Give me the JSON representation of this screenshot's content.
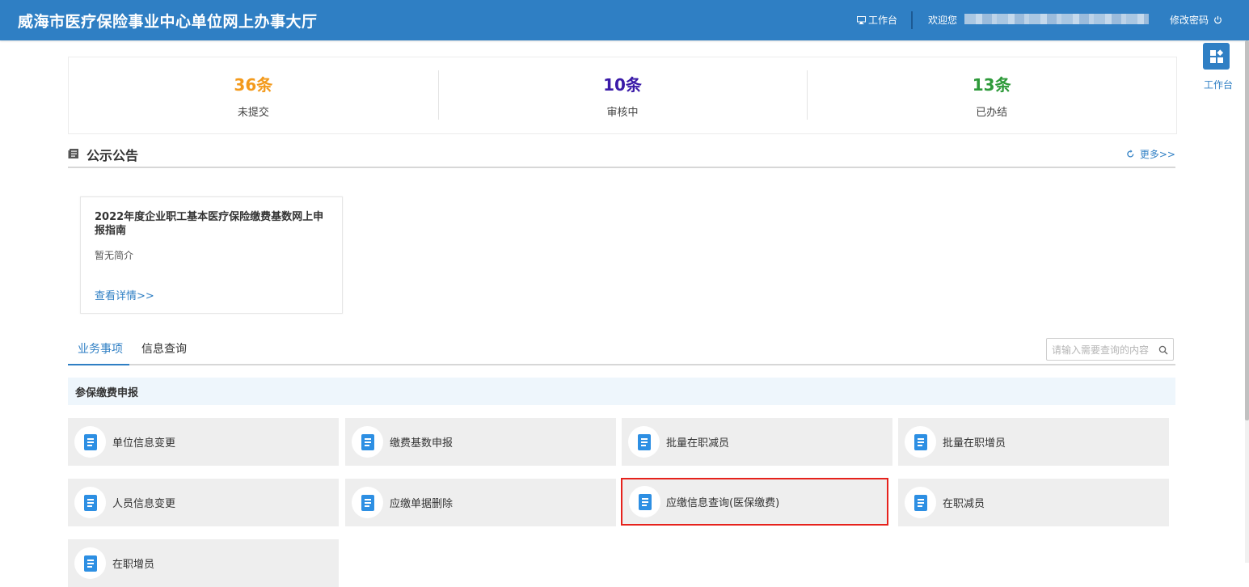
{
  "header": {
    "title": "威海市医疗保险事业中心单位网上办事大厅",
    "workbench_label": "工作台",
    "welcome_label": "欢迎您",
    "change_password_label": "修改密码"
  },
  "stats": [
    {
      "value": "36条",
      "label": "未提交",
      "color": "#f39a1c"
    },
    {
      "value": "10条",
      "label": "审核中",
      "color": "#3a1aa8"
    },
    {
      "value": "13条",
      "label": "已办结",
      "color": "#2e9a3a"
    }
  ],
  "notices": {
    "section_title": "公示公告",
    "more_label": "更多>>",
    "items": [
      {
        "title": "2022年度企业职工基本医疗保险缴费基数网上申报指南",
        "summary": "暂无简介",
        "link_label": "查看详情>>"
      }
    ]
  },
  "tabs": [
    {
      "label": "业务事项",
      "active": true
    },
    {
      "label": "信息查询",
      "active": false
    }
  ],
  "search": {
    "placeholder": "请输入需要查询的内容",
    "value": ""
  },
  "category": {
    "title": "参保缴费申报"
  },
  "services": [
    {
      "label": "单位信息变更"
    },
    {
      "label": "缴费基数申报"
    },
    {
      "label": "批量在职减员"
    },
    {
      "label": "批量在职增员"
    },
    {
      "label": "人员信息变更"
    },
    {
      "label": "应缴单据删除"
    },
    {
      "label": "应缴信息查询(医保缴费)",
      "highlighted": true
    },
    {
      "label": "在职减员"
    },
    {
      "label": "在职增员"
    }
  ],
  "float_workbench": {
    "label": "工作台",
    "icon": "apps-icon"
  },
  "colors": {
    "primary": "#2f7fc4",
    "highlight": "#e6221c"
  }
}
